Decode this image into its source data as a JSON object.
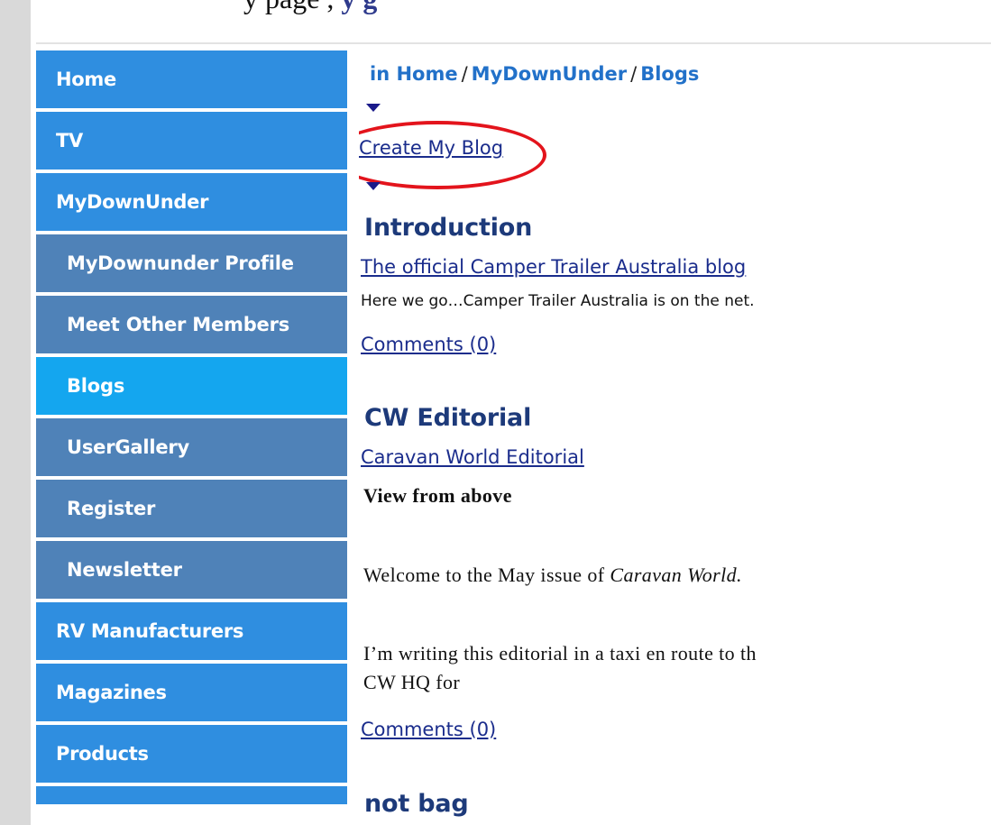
{
  "header": {
    "top_text": "y      page    ,",
    "top_link": "y     g"
  },
  "sidebar": {
    "items": [
      {
        "label": "Home"
      },
      {
        "label": "TV"
      },
      {
        "label": "MyDownUnder"
      },
      {
        "label": "MyDownunder Profile"
      },
      {
        "label": "Meet Other Members"
      },
      {
        "label": "Blogs"
      },
      {
        "label": "UserGallery"
      },
      {
        "label": "Register"
      },
      {
        "label": "Newsletter"
      },
      {
        "label": "RV Manufacturers"
      },
      {
        "label": "Magazines"
      },
      {
        "label": "Products"
      }
    ]
  },
  "breadcrumb": {
    "part1": "in Home",
    "part2": "MyDownUnder",
    "part3": "Blogs",
    "separator": "/"
  },
  "main": {
    "create_link": "Create My Blog",
    "posts": [
      {
        "title": "Introduction",
        "subtitle": "The official Camper Trailer Australia blog",
        "excerpt": "Here we go…Camper Trailer Australia is on the net.",
        "comments": "Comments (0)"
      },
      {
        "title": "CW Editorial",
        "subtitle": "Caravan World Editorial",
        "heading": "View from above",
        "welcome_prefix": "Welcome to the May issue of",
        "welcome_italic": "Caravan World.",
        "line1": "I’m writing this editorial in a taxi en route to th",
        "line2": "CW HQ for",
        "comments": "Comments (0)"
      },
      {
        "title": "not bag"
      }
    ]
  },
  "colors": {
    "nav_top": "#2f8ee0",
    "nav_sub": "#4f82b8",
    "nav_active": "#14a6ef",
    "highlight": "#e3141c",
    "link": "#1a2c8c"
  }
}
